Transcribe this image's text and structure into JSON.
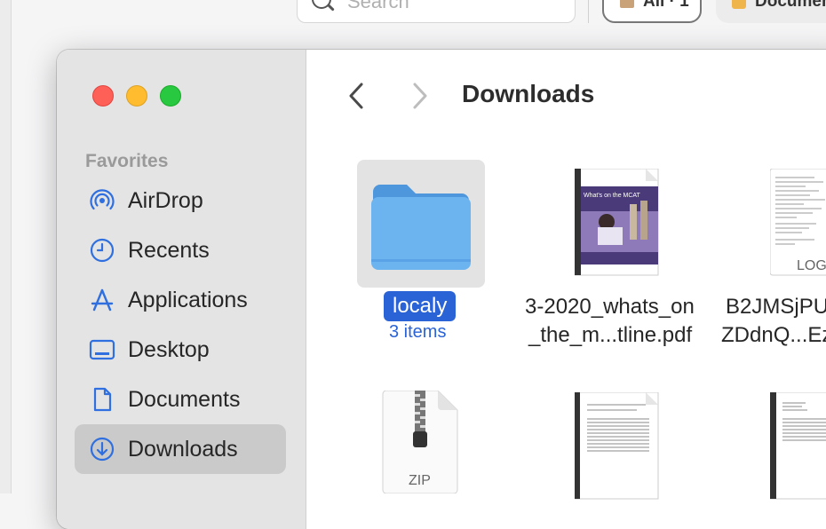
{
  "background": {
    "search_placeholder": "Search",
    "chip_all": "All · 1",
    "chip_documents": "Documents"
  },
  "window": {
    "title": "Downloads",
    "traffic_lights": [
      "close",
      "minimize",
      "zoom"
    ]
  },
  "sidebar": {
    "section_title": "Favorites",
    "items": [
      {
        "label": "AirDrop",
        "icon": "airdrop-icon"
      },
      {
        "label": "Recents",
        "icon": "clock-icon"
      },
      {
        "label": "Applications",
        "icon": "applications-icon"
      },
      {
        "label": "Desktop",
        "icon": "desktop-icon"
      },
      {
        "label": "Documents",
        "icon": "document-icon"
      },
      {
        "label": "Downloads",
        "icon": "download-icon",
        "selected": true
      }
    ]
  },
  "files": [
    {
      "name": "localy",
      "subtitle": "3 items",
      "type": "folder",
      "selected": true
    },
    {
      "name_line1": "3-2020_whats_on",
      "name_line2": "_the_m...tline.pdf",
      "type": "pdf",
      "cover_text": "What's on the MCAT"
    },
    {
      "name_line1": "B2JMSjPU",
      "name_line2": "ZDdnQ...Ez",
      "type": "log",
      "badge": "LOG"
    },
    {
      "type": "zip",
      "badge": "ZIP"
    },
    {
      "type": "pdf"
    },
    {
      "type": "pdf"
    }
  ],
  "colors": {
    "accent": "#2a63d6",
    "sidebar_icon": "#2f6fe0",
    "folder": "#6cb4f0"
  }
}
